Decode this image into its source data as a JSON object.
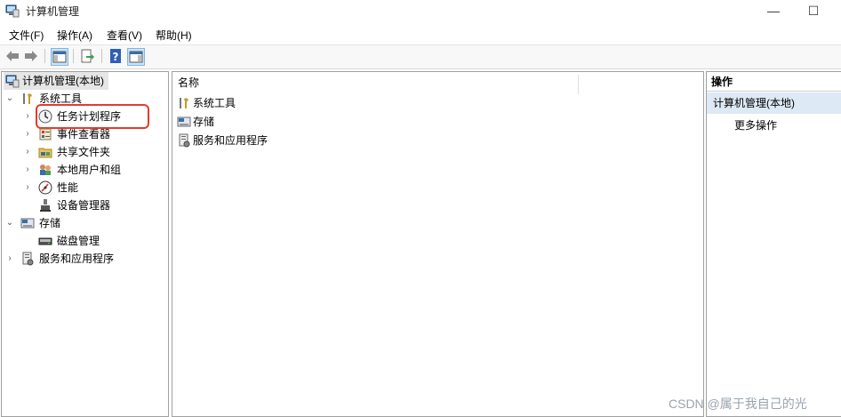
{
  "window": {
    "title": "计算机管理",
    "minimize": "—",
    "maximize": "☐"
  },
  "menu": [
    "文件(F)",
    "操作(A)",
    "查看(V)",
    "帮助(H)"
  ],
  "toolbar": {
    "buttons": [
      "back-icon",
      "forward-icon",
      "show-hide-tree-icon",
      "export-list-icon",
      "help-icon",
      "properties-icon"
    ]
  },
  "tree": {
    "root": "计算机管理(本地)",
    "items": [
      {
        "label": "系统工具",
        "icon": "tools-icon",
        "level": 1,
        "expander": "⌄"
      },
      {
        "label": "任务计划程序",
        "icon": "clock-icon",
        "level": 2,
        "expander": "›"
      },
      {
        "label": "事件查看器",
        "icon": "event-viewer-icon",
        "level": 2,
        "expander": "›"
      },
      {
        "label": "共享文件夹",
        "icon": "shared-folder-icon",
        "level": 2,
        "expander": "›"
      },
      {
        "label": "本地用户和组",
        "icon": "users-icon",
        "level": 2,
        "expander": "›"
      },
      {
        "label": "性能",
        "icon": "performance-icon",
        "level": 2,
        "expander": "›"
      },
      {
        "label": "设备管理器",
        "icon": "device-manager-icon",
        "level": 2,
        "expander": ""
      },
      {
        "label": "存储",
        "icon": "storage-icon",
        "level": 1,
        "expander": "⌄"
      },
      {
        "label": "磁盘管理",
        "icon": "disk-icon",
        "level": 2,
        "expander": ""
      },
      {
        "label": "服务和应用程序",
        "icon": "services-icon",
        "level": 1,
        "expander": "›"
      }
    ]
  },
  "main": {
    "column_header": "名称",
    "rows": [
      {
        "label": "系统工具",
        "icon": "tools-icon"
      },
      {
        "label": "存储",
        "icon": "storage-icon"
      },
      {
        "label": "服务和应用程序",
        "icon": "services-icon"
      }
    ]
  },
  "actions": {
    "header": "操作",
    "selected": "计算机管理(本地)",
    "more": "更多操作"
  },
  "watermark": "CSDN @属于我自己的光",
  "colors": {
    "selection": "#dde9f5",
    "highlight_box": "#e53b2e",
    "pane_border": "#a0a0a0"
  }
}
